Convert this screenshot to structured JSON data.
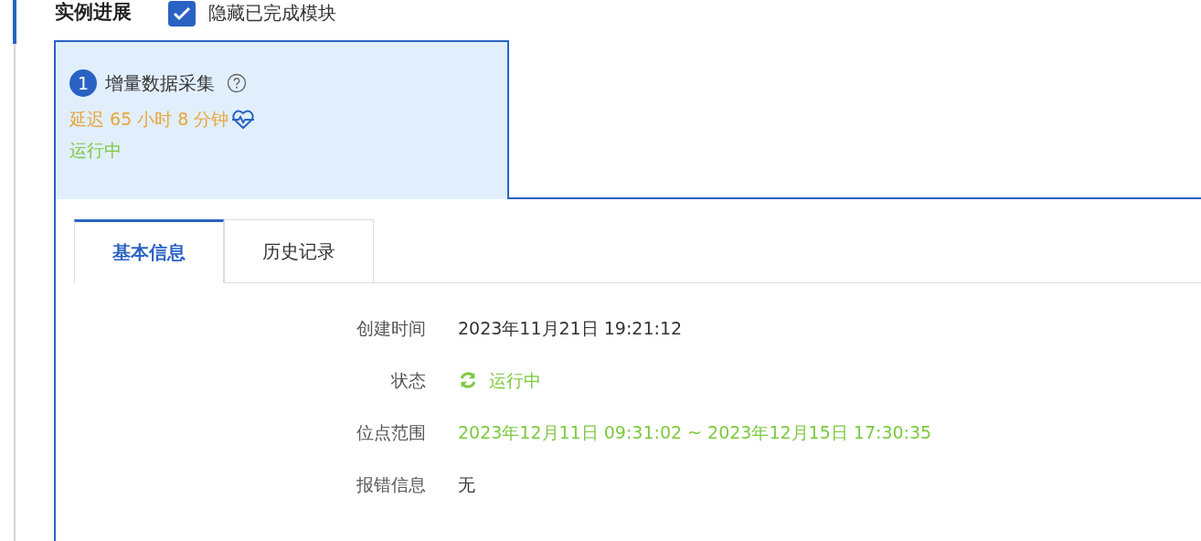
{
  "header": {
    "title": "实例进展",
    "hide_completed": {
      "label": "隐藏已完成模块",
      "checked": true
    }
  },
  "modules": [
    {
      "index": "1",
      "name": "增量数据采集",
      "delay": "延迟 65 小时 8 分钟",
      "status": "运行中",
      "selected": true
    }
  ],
  "tabs": [
    {
      "label": "基本信息",
      "selected": true
    },
    {
      "label": "历史记录",
      "selected": false
    }
  ],
  "details": [
    {
      "label": "创建时间",
      "value": "2023年11月21日 19:21:12",
      "kind": "text"
    },
    {
      "label": "状态",
      "value": "运行中",
      "kind": "status"
    },
    {
      "label": "位点范围",
      "value": "2023年12月11日 09:31:02 ~ 2023年12月15日 17:30:35",
      "kind": "range"
    },
    {
      "label": "报错信息",
      "value": "无",
      "kind": "text"
    }
  ]
}
